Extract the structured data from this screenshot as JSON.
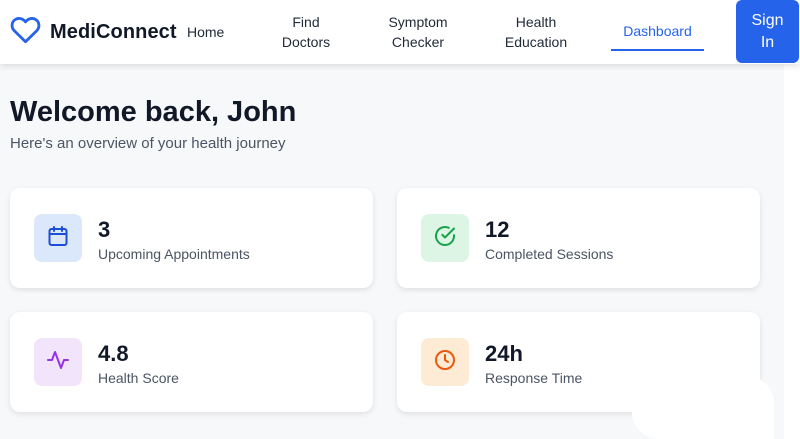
{
  "brand": {
    "name": "MediConnect",
    "logo_icon": "heart-outline",
    "accent_color": "#2563eb"
  },
  "nav": {
    "home": "Home",
    "find_doctors": [
      "Find",
      "Doctors"
    ],
    "symptom_checker": [
      "Symptom",
      "Checker"
    ],
    "health_education": [
      "Health",
      "Education"
    ],
    "dashboard": "Dashboard",
    "active_item": "Dashboard",
    "sign_in": [
      "Sign",
      "In"
    ]
  },
  "main": {
    "title": "Welcome back, John",
    "subtitle": "Here's an overview of your health journey"
  },
  "stats": [
    {
      "value": "3",
      "label": "Upcoming Appointments",
      "icon": "calendar-icon",
      "icon_color": "#1d4ed8",
      "icon_bg": "#dbe7fb"
    },
    {
      "value": "12",
      "label": "Completed Sessions",
      "icon": "check-circle-icon",
      "icon_color": "#16a34a",
      "icon_bg": "#dcf5e4"
    },
    {
      "value": "4.8",
      "label": "Health Score",
      "icon": "activity-icon",
      "icon_color": "#9333ea",
      "icon_bg": "#f2e4fb"
    },
    {
      "value": "24h",
      "label": "Response Time",
      "icon": "clock-icon",
      "icon_color": "#ea580c",
      "icon_bg": "#fdebd5"
    }
  ]
}
